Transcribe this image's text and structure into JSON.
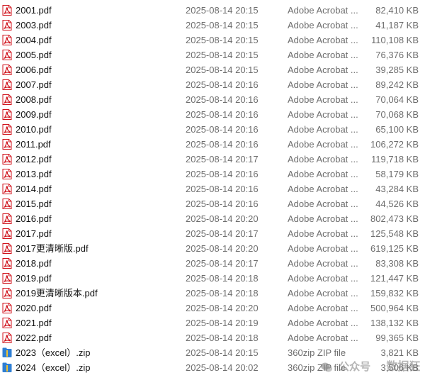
{
  "colors": {
    "pdf_icon": "#d0121b",
    "zip_icon": "#2f7fd4",
    "text": "#111111",
    "meta_text": "#6d6d6d"
  },
  "files": [
    {
      "name": "2001.pdf",
      "modified": "2025-08-14 20:15",
      "type": "Adobe Acrobat ...",
      "size": "82,410 KB",
      "icon": "pdf-file-icon"
    },
    {
      "name": "2003.pdf",
      "modified": "2025-08-14 20:15",
      "type": "Adobe Acrobat ...",
      "size": "41,187 KB",
      "icon": "pdf-file-icon"
    },
    {
      "name": "2004.pdf",
      "modified": "2025-08-14 20:15",
      "type": "Adobe Acrobat ...",
      "size": "110,108 KB",
      "icon": "pdf-file-icon"
    },
    {
      "name": "2005.pdf",
      "modified": "2025-08-14 20:15",
      "type": "Adobe Acrobat ...",
      "size": "76,376 KB",
      "icon": "pdf-file-icon"
    },
    {
      "name": "2006.pdf",
      "modified": "2025-08-14 20:15",
      "type": "Adobe Acrobat ...",
      "size": "39,285 KB",
      "icon": "pdf-file-icon"
    },
    {
      "name": "2007.pdf",
      "modified": "2025-08-14 20:16",
      "type": "Adobe Acrobat ...",
      "size": "89,242 KB",
      "icon": "pdf-file-icon"
    },
    {
      "name": "2008.pdf",
      "modified": "2025-08-14 20:16",
      "type": "Adobe Acrobat ...",
      "size": "70,064 KB",
      "icon": "pdf-file-icon"
    },
    {
      "name": "2009.pdf",
      "modified": "2025-08-14 20:16",
      "type": "Adobe Acrobat ...",
      "size": "70,068 KB",
      "icon": "pdf-file-icon"
    },
    {
      "name": "2010.pdf",
      "modified": "2025-08-14 20:16",
      "type": "Adobe Acrobat ...",
      "size": "65,100 KB",
      "icon": "pdf-file-icon"
    },
    {
      "name": "2011.pdf",
      "modified": "2025-08-14 20:16",
      "type": "Adobe Acrobat ...",
      "size": "106,272 KB",
      "icon": "pdf-file-icon"
    },
    {
      "name": "2012.pdf",
      "modified": "2025-08-14 20:17",
      "type": "Adobe Acrobat ...",
      "size": "119,718 KB",
      "icon": "pdf-file-icon"
    },
    {
      "name": "2013.pdf",
      "modified": "2025-08-14 20:16",
      "type": "Adobe Acrobat ...",
      "size": "58,179 KB",
      "icon": "pdf-file-icon"
    },
    {
      "name": "2014.pdf",
      "modified": "2025-08-14 20:16",
      "type": "Adobe Acrobat ...",
      "size": "43,284 KB",
      "icon": "pdf-file-icon"
    },
    {
      "name": "2015.pdf",
      "modified": "2025-08-14 20:16",
      "type": "Adobe Acrobat ...",
      "size": "44,526 KB",
      "icon": "pdf-file-icon"
    },
    {
      "name": "2016.pdf",
      "modified": "2025-08-14 20:20",
      "type": "Adobe Acrobat ...",
      "size": "802,473 KB",
      "icon": "pdf-file-icon"
    },
    {
      "name": "2017.pdf",
      "modified": "2025-08-14 20:17",
      "type": "Adobe Acrobat ...",
      "size": "125,548 KB",
      "icon": "pdf-file-icon"
    },
    {
      "name": "2017更清晰版.pdf",
      "modified": "2025-08-14 20:20",
      "type": "Adobe Acrobat ...",
      "size": "619,125 KB",
      "icon": "pdf-file-icon"
    },
    {
      "name": "2018.pdf",
      "modified": "2025-08-14 20:17",
      "type": "Adobe Acrobat ...",
      "size": "83,308 KB",
      "icon": "pdf-file-icon"
    },
    {
      "name": "2019.pdf",
      "modified": "2025-08-14 20:18",
      "type": "Adobe Acrobat ...",
      "size": "121,447 KB",
      "icon": "pdf-file-icon"
    },
    {
      "name": "2019更清晰版本.pdf",
      "modified": "2025-08-14 20:18",
      "type": "Adobe Acrobat ...",
      "size": "159,832 KB",
      "icon": "pdf-file-icon"
    },
    {
      "name": "2020.pdf",
      "modified": "2025-08-14 20:20",
      "type": "Adobe Acrobat ...",
      "size": "500,964 KB",
      "icon": "pdf-file-icon"
    },
    {
      "name": "2021.pdf",
      "modified": "2025-08-14 20:19",
      "type": "Adobe Acrobat ...",
      "size": "138,132 KB",
      "icon": "pdf-file-icon"
    },
    {
      "name": "2022.pdf",
      "modified": "2025-08-14 20:18",
      "type": "Adobe Acrobat ...",
      "size": "99,365 KB",
      "icon": "pdf-file-icon"
    },
    {
      "name": "2023（excel）.zip",
      "modified": "2025-08-14 20:15",
      "type": "360zip ZIP file",
      "size": "3,821 KB",
      "icon": "zip-archive-icon"
    },
    {
      "name": "2024（excel）.zip",
      "modified": "2025-08-14 20:02",
      "type": "360zip ZIP file",
      "size": "3,506 KB",
      "icon": "zip-archive-icon"
    }
  ],
  "watermark": {
    "platform": "公众号",
    "brand": "数据狂",
    "icon": "wechat-icon"
  }
}
